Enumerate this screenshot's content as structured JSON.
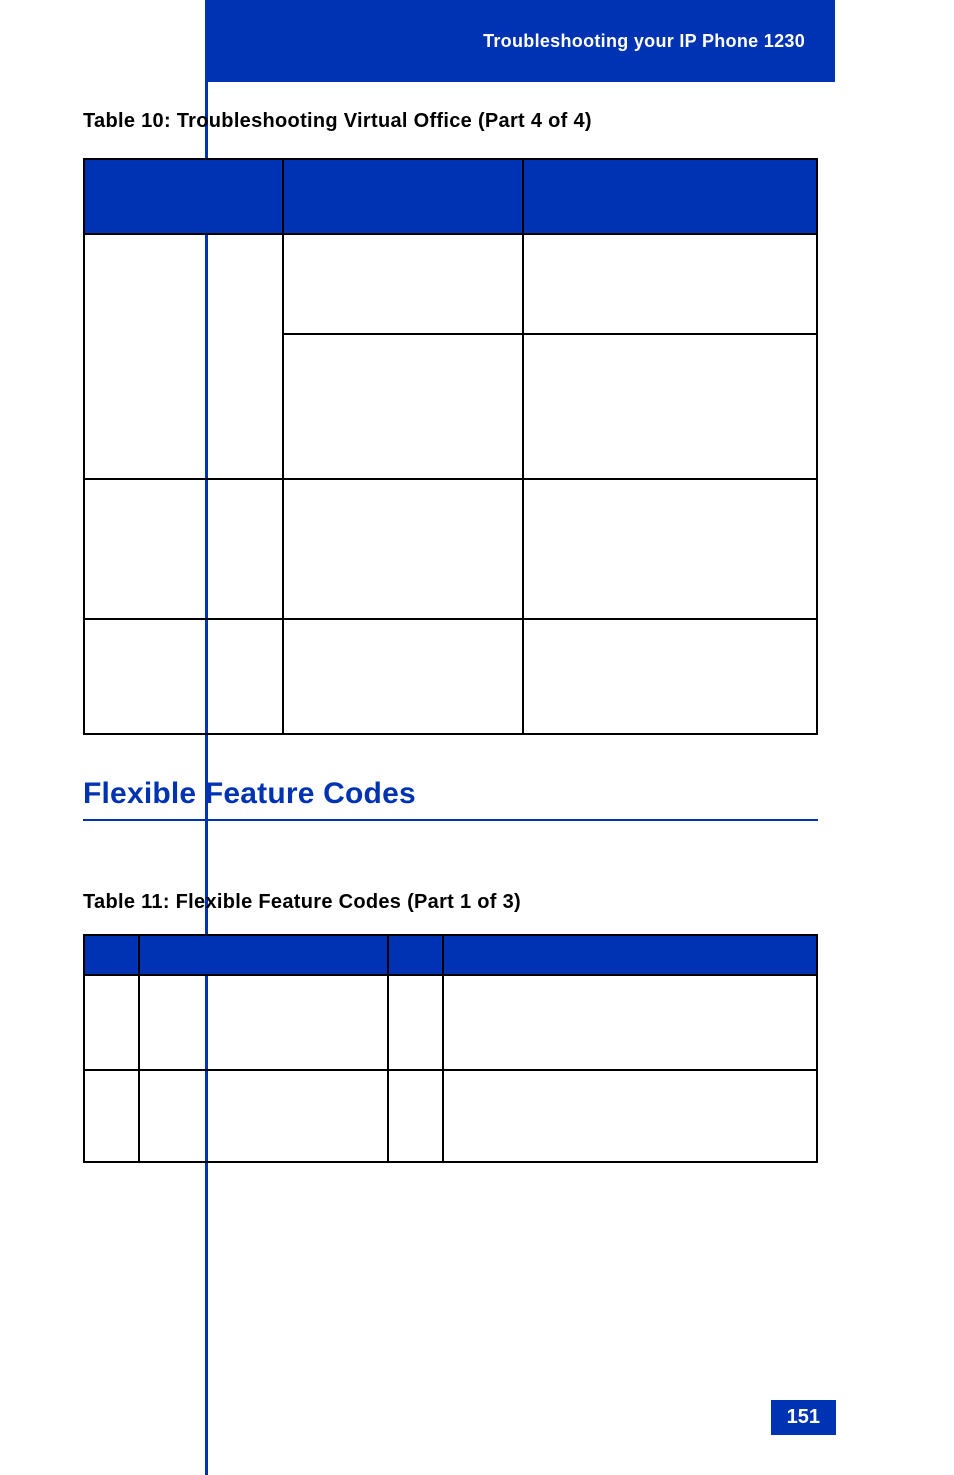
{
  "header": {
    "title": "Troubleshooting your IP Phone 1230"
  },
  "table10": {
    "caption": "Table 10: Troubleshooting Virtual Office (Part 4 of 4)"
  },
  "section": {
    "heading": "Flexible Feature Codes"
  },
  "table11": {
    "caption": "Table 11: Flexible Feature Codes  (Part 1 of 3)"
  },
  "page": {
    "number": "151"
  }
}
